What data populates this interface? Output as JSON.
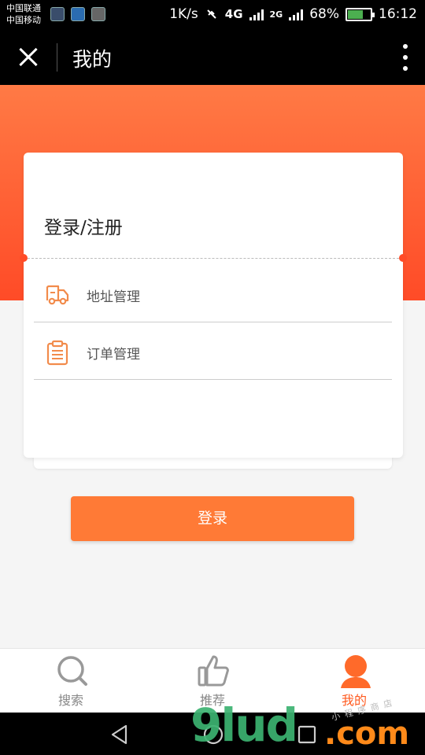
{
  "status_bar": {
    "carrier1": "中国联通",
    "carrier2": "中国移动",
    "speed": "1K/s",
    "net1": "4G",
    "net2": "2G",
    "battery": "68%",
    "battery_level": 0.68,
    "time": "16:12"
  },
  "title_bar": {
    "title": "我的",
    "close_icon": "close-icon",
    "more_icon": "more-vertical-icon"
  },
  "colors": {
    "header_top": "#ff7a45",
    "header_bottom": "#ff4b27",
    "button": "#ff7a36",
    "active_tab": "#ff5a1f",
    "inactive_tab": "#888888"
  },
  "card": {
    "title": "登录/注册",
    "items": [
      {
        "label": "地址管理",
        "icon": "truck-icon"
      },
      {
        "label": "订单管理",
        "icon": "clipboard-icon"
      }
    ]
  },
  "login_button": "登录",
  "tabs": [
    {
      "label": "搜索",
      "icon": "search-icon",
      "active": false
    },
    {
      "label": "推荐",
      "icon": "thumbs-up-icon",
      "active": false
    },
    {
      "label": "我的",
      "icon": "user-icon",
      "active": true
    }
  ],
  "watermark": {
    "main": "9lud",
    "suffix": ".com",
    "small": "小程序商店"
  }
}
